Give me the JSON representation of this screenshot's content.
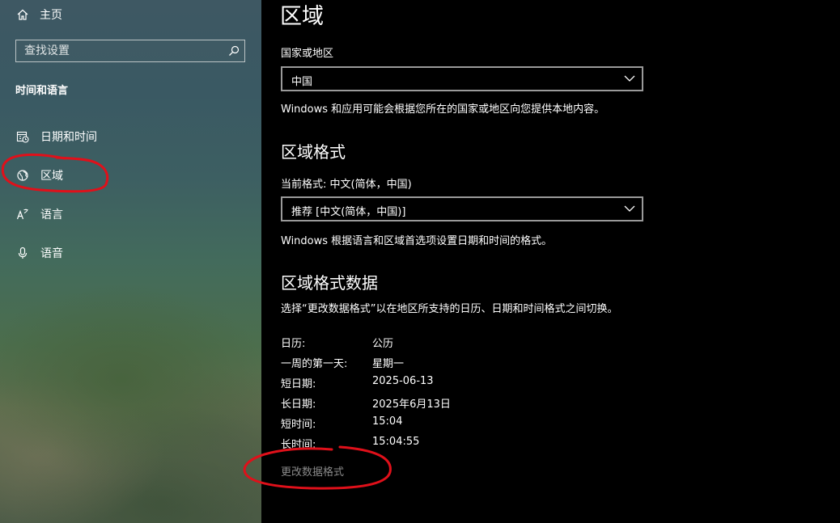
{
  "sidebar": {
    "home_label": "主页",
    "search": {
      "placeholder": "查找设置"
    },
    "section_title": "时间和语言",
    "items": [
      {
        "label": "日期和时间",
        "icon": "calendar-clock-icon"
      },
      {
        "label": "区域",
        "icon": "globe-icon"
      },
      {
        "label": "语言",
        "icon": "language-icon"
      },
      {
        "label": "语音",
        "icon": "microphone-icon"
      }
    ]
  },
  "main": {
    "title": "区域",
    "country": {
      "label": "国家或地区",
      "value": "中国",
      "description": "Windows 和应用可能会根据您所在的国家或地区向您提供本地内容。"
    },
    "format": {
      "heading": "区域格式",
      "current_label": "当前格式: 中文(简体，中国)",
      "value": "推荐 [中文(简体，中国)]",
      "description": "Windows 根据语言和区域首选项设置日期和时间的格式。"
    },
    "format_data": {
      "heading": "区域格式数据",
      "description": "选择“更改数据格式”以在地区所支持的日历、日期和时间格式之间切换。",
      "rows": [
        {
          "key": "日历:",
          "value": "公历"
        },
        {
          "key": "一周的第一天:",
          "value": "星期一"
        },
        {
          "key": "短日期:",
          "value": "2025-06-13"
        },
        {
          "key": "长日期:",
          "value": "2025年6月13日"
        },
        {
          "key": "短时间:",
          "value": "15:04"
        },
        {
          "key": "长时间:",
          "value": "15:04:55"
        }
      ],
      "change_link": "更改数据格式"
    }
  },
  "colors": {
    "annotation": "#e0101a",
    "link_disabled": "#8a8a8a"
  }
}
